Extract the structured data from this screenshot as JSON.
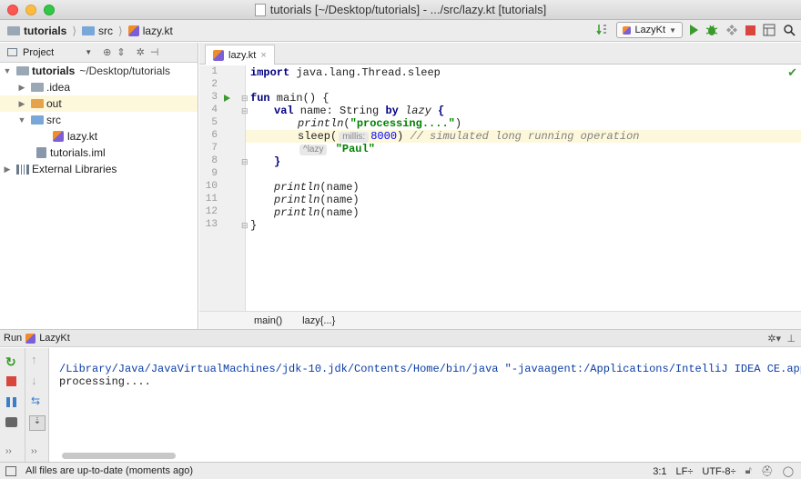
{
  "window": {
    "title": "tutorials [~/Desktop/tutorials] - .../src/lazy.kt [tutorials]",
    "colors": {
      "close": "#fc5753",
      "minimize": "#fdbc40",
      "zoom": "#33c748"
    }
  },
  "breadcrumb": {
    "project": "tutorials",
    "folder": "src",
    "file": "lazy.kt"
  },
  "toolbar": {
    "run_config": "LazyKt"
  },
  "project_panel": {
    "header": "Project",
    "root_name": "tutorials",
    "root_path": "~/Desktop/tutorials",
    "items": [
      {
        "label": ".idea"
      },
      {
        "label": "out"
      },
      {
        "label": "src"
      },
      {
        "label": "lazy.kt"
      },
      {
        "label": "tutorials.iml"
      },
      {
        "label": "External Libraries"
      }
    ]
  },
  "editor": {
    "tab_label": "lazy.kt",
    "line_numbers": [
      "1",
      "2",
      "3",
      "4",
      "5",
      "6",
      "7",
      "8",
      "9",
      "10",
      "11",
      "12",
      "13"
    ],
    "code": {
      "l1_kw": "import",
      "l1_rest": " java.lang.Thread.sleep",
      "l3_kw": "fun",
      "l3_rest": " main() {",
      "l4_kw1": "val",
      "l4_mid": " name: String ",
      "l4_kw2": "by",
      "l4_lazy": "lazy",
      "l4_brace": " {",
      "l5_fn": "println",
      "l5_open": "(",
      "l5_str": "\"processing....\"",
      "l5_close": ")",
      "l6_fn": "sleep(",
      "l6_hint": "millis:",
      "l6_num": "8000",
      "l6_close": ")",
      "l6_comment": "// simulated long running operation",
      "l7_hint": "^lazy",
      "l7_str": "\"Paul\"",
      "l8": "}",
      "l10_fn": "println",
      "l10_rest": "(name)",
      "l11_fn": "println",
      "l11_rest": "(name)",
      "l12_fn": "println",
      "l12_rest": "(name)",
      "l13": "}"
    },
    "breadcrumb": {
      "fn": "main()",
      "block": "lazy{...}"
    }
  },
  "run_panel": {
    "header_label": "Run",
    "config": "LazyKt",
    "console_lines": [
      "/Library/Java/JavaVirtualMachines/jdk-10.jdk/Contents/Home/bin/java \"-javaagent:/Applications/IntelliJ IDEA CE.app/Contents/l",
      "processing...."
    ]
  },
  "status_bar": {
    "message": "All files are up-to-date (moments ago)",
    "position": "3:1",
    "line_sep": "LF÷",
    "encoding": "UTF-8÷"
  }
}
